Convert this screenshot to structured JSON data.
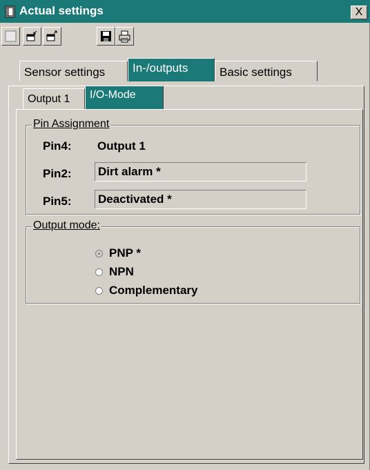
{
  "window": {
    "title": "Actual settings",
    "close_glyph": "X"
  },
  "toolbar": {
    "buttons": [
      {
        "icon": "blank-icon"
      },
      {
        "icon": "import-icon"
      },
      {
        "icon": "export-icon"
      },
      {
        "icon": "save-icon"
      },
      {
        "icon": "print-icon"
      }
    ]
  },
  "tabs": {
    "top": [
      {
        "label": "Sensor settings",
        "active": false
      },
      {
        "label": "In-/outputs",
        "active": true
      },
      {
        "label": "Basic settings",
        "active": false
      }
    ],
    "sub": [
      {
        "label": "Output 1",
        "active": false
      },
      {
        "label": "I/O-Mode",
        "active": true
      }
    ]
  },
  "pin_assignment": {
    "title": "Pin Assignment",
    "rows": [
      {
        "label": "Pin4:",
        "value": "Output 1"
      },
      {
        "label": "Pin2:",
        "value": "Dirt alarm *"
      },
      {
        "label": "Pin5:",
        "value": "Deactivated *"
      }
    ]
  },
  "output_mode": {
    "title": "Output mode:",
    "options": [
      {
        "label": "PNP *",
        "selected": true
      },
      {
        "label": "NPN",
        "selected": false
      },
      {
        "label": "Complementary",
        "selected": false
      }
    ]
  },
  "colors": {
    "accent": "#1b7a78",
    "face": "#d4d0c8"
  }
}
